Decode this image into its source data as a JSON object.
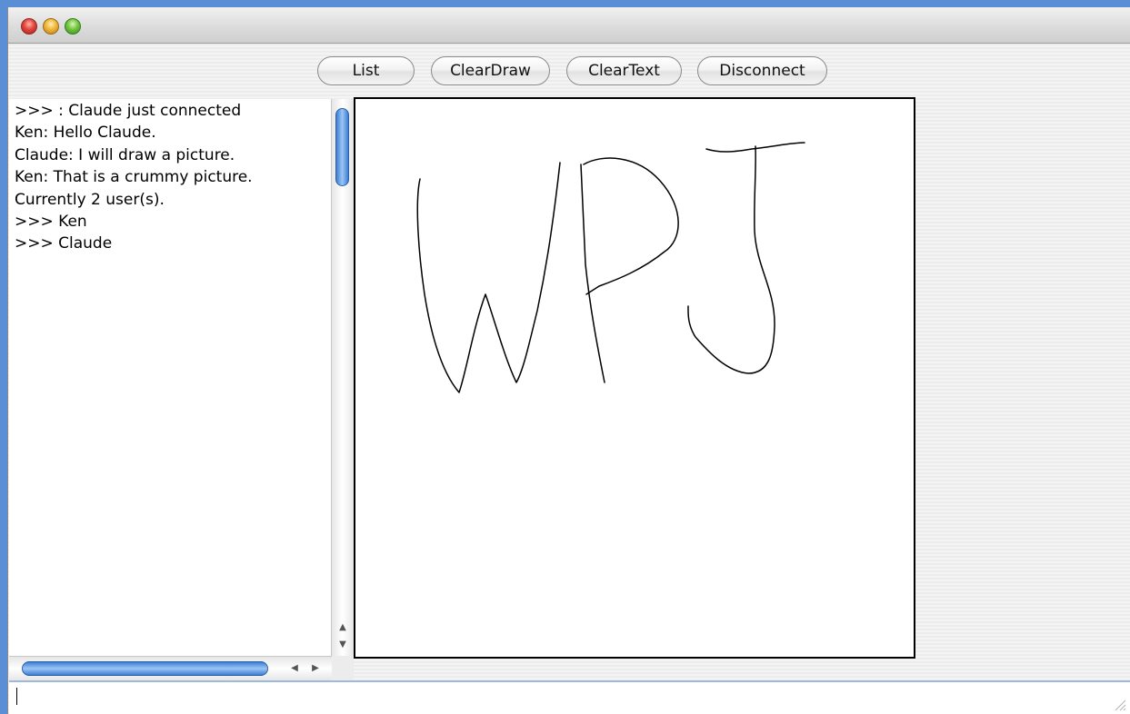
{
  "window": {
    "traffic_lights": [
      "close",
      "minimize",
      "zoom"
    ]
  },
  "toolbar": {
    "list_label": "List",
    "clear_draw_label": "ClearDraw",
    "clear_text_label": "ClearText",
    "disconnect_label": "Disconnect"
  },
  "chat": {
    "messages": [
      ">>> : Claude just connected",
      "Ken: Hello Claude.",
      "Claude: I will draw a picture.",
      "Ken: That is a crummy picture.",
      "Currently 2 user(s).",
      ">>> Ken",
      ">>> Claude"
    ]
  },
  "scrollbars": {
    "up_arrow": "▲",
    "down_arrow": "▼",
    "left_arrow": "◀",
    "right_arrow": "▶"
  },
  "input": {
    "value": ""
  }
}
